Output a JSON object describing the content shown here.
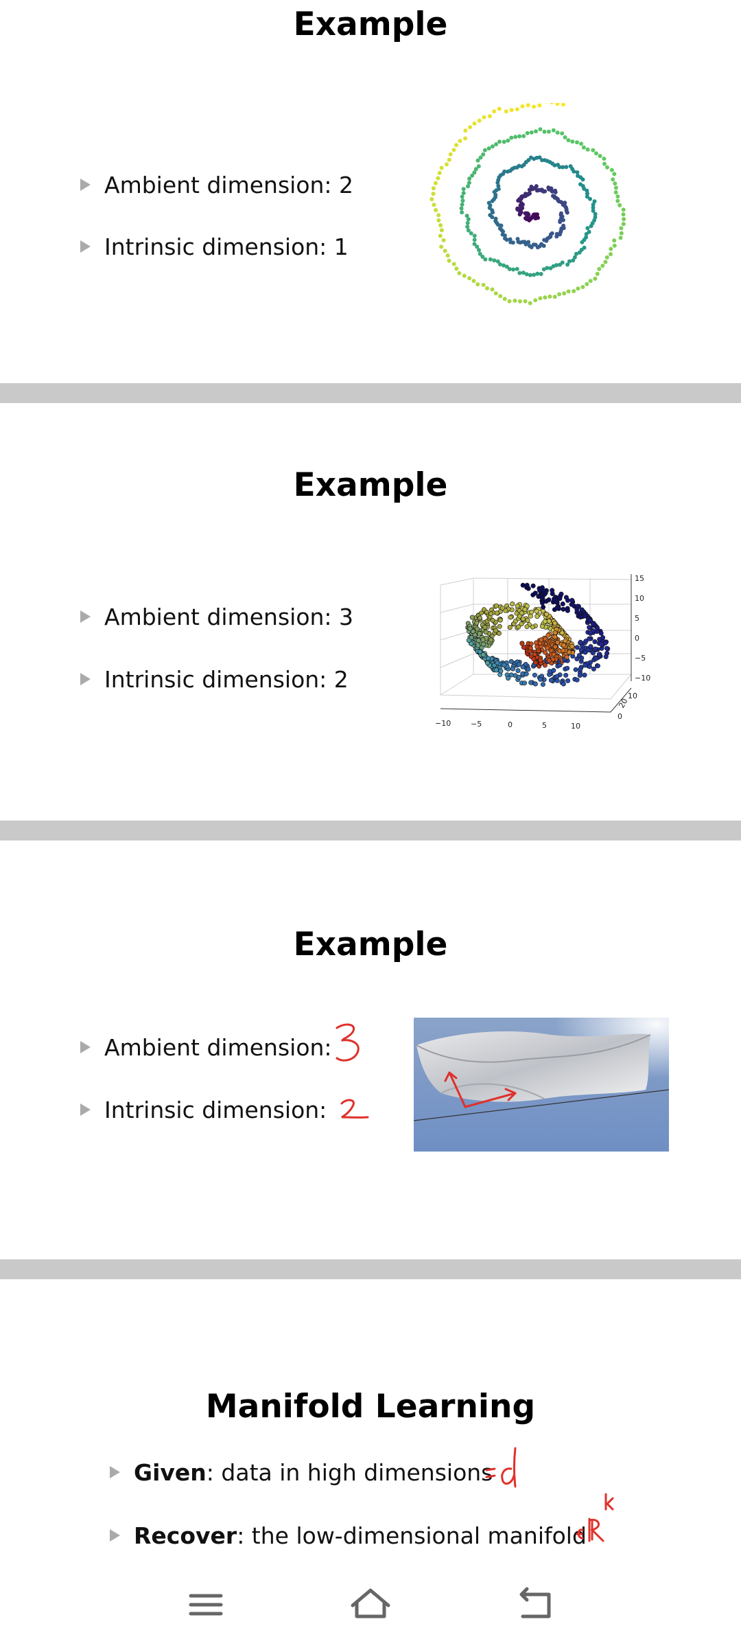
{
  "slides": [
    {
      "title": "Example",
      "bullets": [
        {
          "label": "Ambient dimension: 2"
        },
        {
          "label": "Intrinsic dimension: 1"
        }
      ],
      "figure": "spiral-scatter-plot"
    },
    {
      "title": "Example",
      "bullets": [
        {
          "label": "Ambient dimension: 3"
        },
        {
          "label": "Intrinsic dimension: 2"
        }
      ],
      "figure": "swiss-roll-3d-scatter",
      "axis_ticks": {
        "x": [
          "−10",
          "−5",
          "0",
          "5",
          "10"
        ],
        "z": [
          "15",
          "10",
          "5",
          "0",
          "−5",
          "−10"
        ],
        "y": [
          "10",
          "20",
          "0"
        ]
      }
    },
    {
      "title": "Example",
      "bullets": [
        {
          "label": "Ambient dimension:",
          "handwritten": "3"
        },
        {
          "label": "Intrinsic dimension:",
          "handwritten": "2"
        }
      ],
      "figure": "cloth-photo-with-arrows"
    },
    {
      "title": "Manifold Learning",
      "bullets": [
        {
          "bold": "Given",
          "rest": ": data in high dimensions",
          "handwritten": "≈ d"
        },
        {
          "bold": "Recover",
          "rest": ": the low-dimensional manifold",
          "handwritten": "∈ ℝ^k"
        }
      ]
    }
  ],
  "navigation": {
    "menu_icon": "hamburger-menu-icon",
    "home_icon": "home-icon",
    "back_icon": "back-icon"
  },
  "colors": {
    "separator": "#c9c9c9",
    "annotation_red": "#e0302a",
    "bullet_marker": "#aaaaaa"
  }
}
